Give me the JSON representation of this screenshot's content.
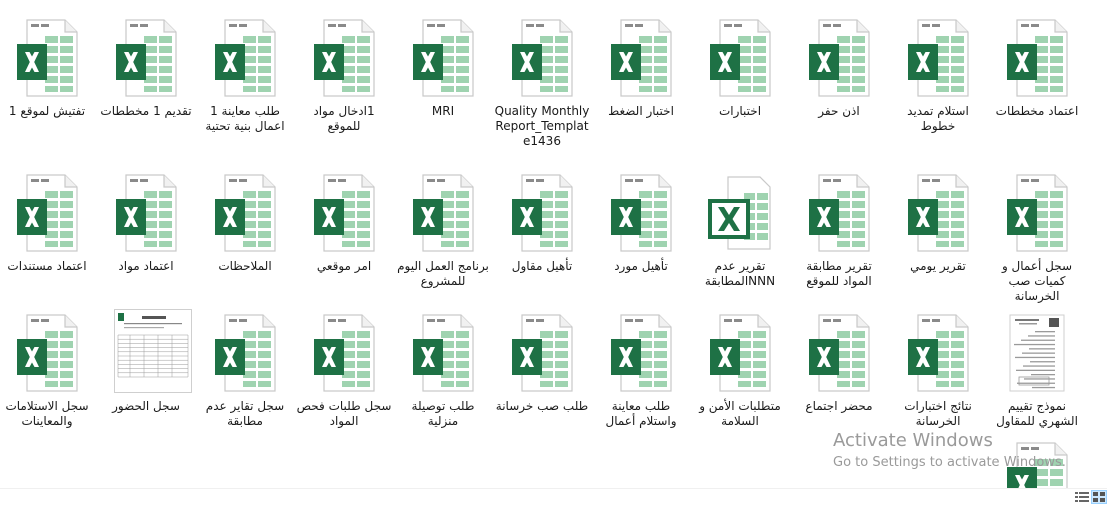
{
  "files": [
    {
      "name": "اعتماد مخططات",
      "type": "excel"
    },
    {
      "name": "استلام تمديد خطوط",
      "type": "excel"
    },
    {
      "name": "اذن حفر",
      "type": "excel"
    },
    {
      "name": "اختبارات",
      "type": "excel"
    },
    {
      "name": "اختبار الضغط",
      "type": "excel"
    },
    {
      "name": "Quality Monthly Report_Templat e1436",
      "type": "excel"
    },
    {
      "name": "MRI",
      "type": "excel"
    },
    {
      "name": "1ادخال مواد للموقع",
      "type": "excel"
    },
    {
      "name": "طلب معاينة 1 اعمال بنية تحتية",
      "type": "excel"
    },
    {
      "name": "تقديم 1 مخططات",
      "type": "excel"
    },
    {
      "name": "تفتيش لموقع 1",
      "type": "excel"
    },
    {
      "name": "سجل أعمال و كميات صب الخرسانة",
      "type": "excel"
    },
    {
      "name": "تقرير يومي",
      "type": "excel"
    },
    {
      "name": "تقرير مطابقة المواد للموقع",
      "type": "excel"
    },
    {
      "name": "تقرير عدم NNNالمطابقة",
      "type": "excel-app"
    },
    {
      "name": "تأهيل مورد",
      "type": "excel"
    },
    {
      "name": "تأهيل مقاول",
      "type": "excel"
    },
    {
      "name": "برنامج العمل اليوم للمشروع",
      "type": "excel"
    },
    {
      "name": "امر موقعي",
      "type": "excel"
    },
    {
      "name": "الملاحظات",
      "type": "excel"
    },
    {
      "name": "اعتماد مواد",
      "type": "excel"
    },
    {
      "name": "اعتماد مستندات",
      "type": "excel"
    },
    {
      "name": "نموذج تقييم الشهري للمقاول",
      "type": "doc-thumb"
    },
    {
      "name": "نتائج اختبارات الخرسانة",
      "type": "excel"
    },
    {
      "name": "محضر اجتماع",
      "type": "excel"
    },
    {
      "name": "متطلبات الأمن و السلامة",
      "type": "excel"
    },
    {
      "name": "طلب معاينة واستلام أعمال",
      "type": "excel"
    },
    {
      "name": "طلب صب خرسانة",
      "type": "excel"
    },
    {
      "name": "طلب توصيلة منزلية",
      "type": "excel"
    },
    {
      "name": "سجل طلبات فحص المواد",
      "type": "excel"
    },
    {
      "name": "سجل تقاير عدم مطابقة",
      "type": "excel"
    },
    {
      "name": "سجل الحضور",
      "type": "sheet-thumb"
    },
    {
      "name": "سجل الاستلامات والمعاينات",
      "type": "excel"
    },
    {
      "name": "",
      "type": "excel"
    }
  ],
  "watermark": {
    "title": "Activate Windows",
    "subtitle": "Go to Settings to activate Windows."
  },
  "statusbar": {
    "details_icon": "details-view-icon",
    "large_icons_icon": "large-icons-view-icon"
  },
  "colors": {
    "excel_green": "#1e7145",
    "excel_light": "#9fd3b0",
    "page_border": "#c9c9c9"
  }
}
